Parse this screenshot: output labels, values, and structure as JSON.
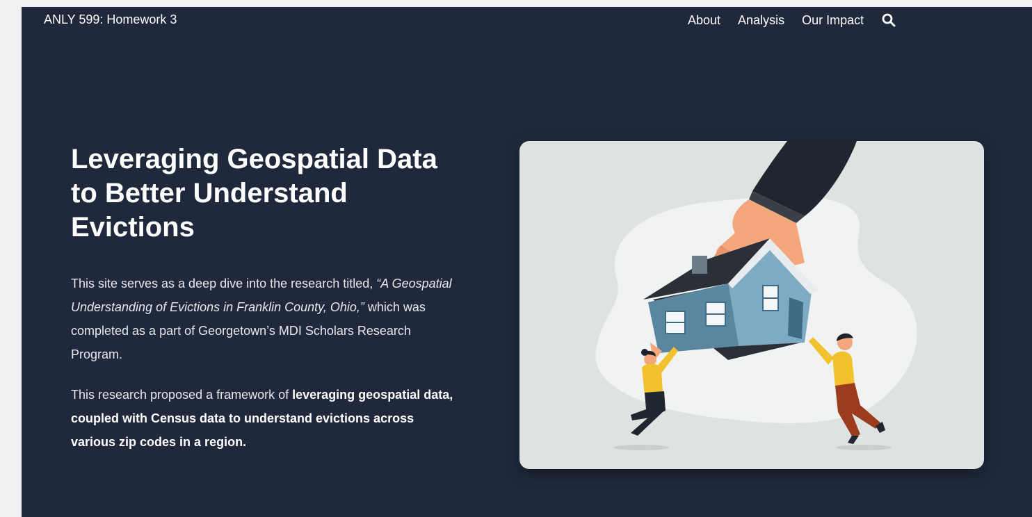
{
  "header": {
    "brand": "ANLY 599: Homework 3",
    "nav": [
      "About",
      "Analysis",
      "Our Impact"
    ],
    "search_icon": "search-icon"
  },
  "hero": {
    "title": "Leveraging Geospatial Data to Better Understand Evictions",
    "desc1": {
      "pre": "This site serves as a deep dive into the research titled, ",
      "quoted": "“A Geospatial Understanding of Evictions in Franklin County, Ohio,”",
      "post": " which was completed as a part of Georgetown’s MDI Scholars Research Program."
    },
    "desc2": {
      "pre": "This research proposed a framework of ",
      "bold": "leveraging geospatial data, coupled with Census data to understand evictions across various zip codes in a region."
    },
    "illustration": "eviction-illustration"
  },
  "colors": {
    "page_bg": "#1f293b",
    "outer_bg": "#f0f0f0",
    "card_bg": "#dee3e2",
    "house_blue": "#5a86a0",
    "skin": "#f4a67d",
    "sleeve": "#20262f",
    "shirt_yellow": "#f2c22e"
  }
}
